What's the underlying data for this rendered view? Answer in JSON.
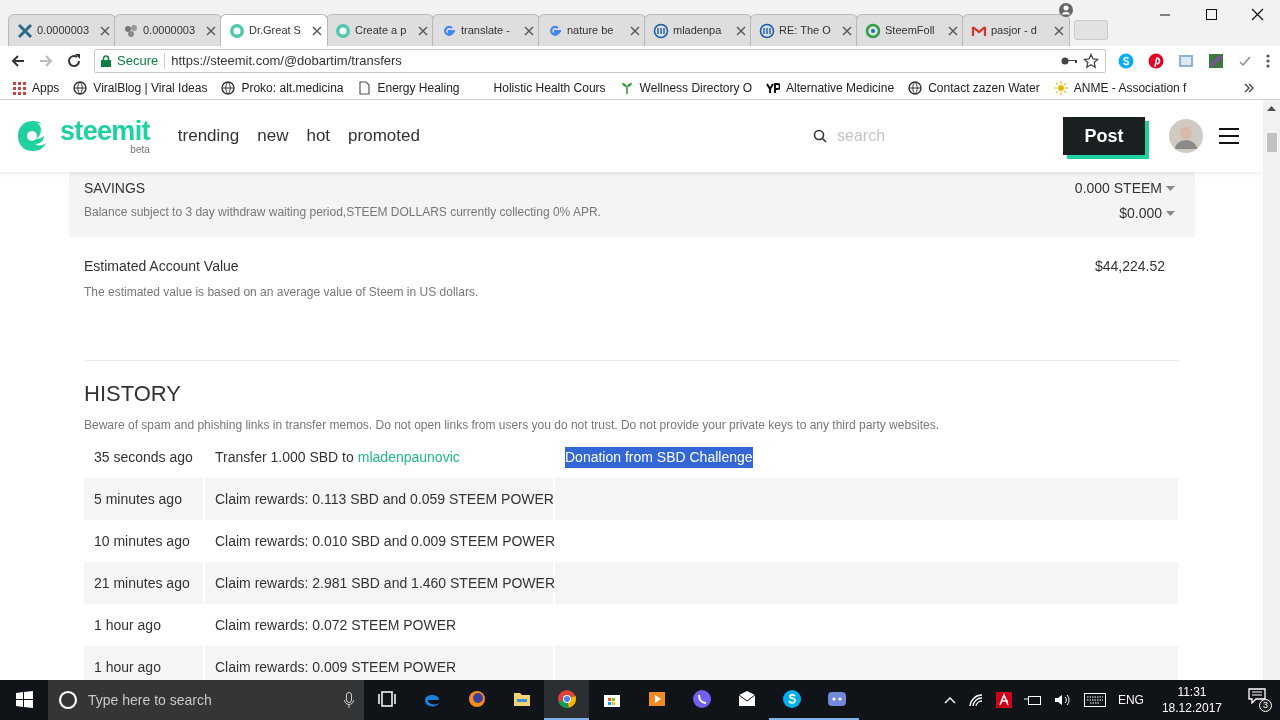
{
  "browser": {
    "tabs": [
      {
        "title": "0.0000003",
        "selected": false
      },
      {
        "title": "0.0000003",
        "selected": false
      },
      {
        "title": "Dr.Great S",
        "selected": true
      },
      {
        "title": "Create a p",
        "selected": false
      },
      {
        "title": "translate -",
        "selected": false
      },
      {
        "title": "nature be",
        "selected": false
      },
      {
        "title": "mladenpa",
        "selected": false
      },
      {
        "title": "RE: The O",
        "selected": false
      },
      {
        "title": "SteemFoll",
        "selected": false
      },
      {
        "title": "pasjor - d",
        "selected": false
      }
    ],
    "secure_label": "Secure",
    "url": "https://steemit.com/@dobartim/transfers",
    "bookmarks": [
      "Apps",
      "ViralBlog | Viral Ideas",
      "Proko: alt.medicina",
      "Energy Healing",
      "Holistic Health Cours",
      "Wellness Directory O",
      "Alternative Medicine",
      "Contact zazen Water",
      "ANME - Association f"
    ]
  },
  "site": {
    "logo": "steemit",
    "logo_sub": "beta",
    "nav": [
      "trending",
      "new",
      "hot",
      "promoted"
    ],
    "search_placeholder": "search",
    "post_button": "Post"
  },
  "savings": {
    "title": "SAVINGS",
    "note": "Balance subject to 3 day withdraw waiting period,STEEM DOLLARS currently collecting 0% APR.",
    "amounts": [
      "0.000 STEEM",
      "$0.000"
    ]
  },
  "estimate": {
    "title": "Estimated Account Value",
    "note": "The estimated value is based on an average value of Steem in US dollars.",
    "value": "$44,224.52"
  },
  "history": {
    "title": "HISTORY",
    "warning": "Beware of spam and phishing links in transfer memos. Do not open links from users you do not trust. Do not provide your private keys to any third party websites.",
    "rows": [
      {
        "time": "35 seconds ago",
        "text": "Transfer 1.000 SBD to",
        "link": "mladenpaunovic",
        "memo": "Donation from SBD Challenge",
        "memo_selected": true
      },
      {
        "time": "5 minutes ago",
        "text": "Claim rewards: 0.113 SBD and 0.059 STEEM POWER"
      },
      {
        "time": "10 minutes ago",
        "text": "Claim rewards: 0.010 SBD and 0.009 STEEM POWER"
      },
      {
        "time": "21 minutes ago",
        "text": "Claim rewards: 2.981 SBD and 1.460 STEEM POWER"
      },
      {
        "time": "1 hour ago",
        "text": "Claim rewards: 0.072 STEEM POWER"
      },
      {
        "time": "1 hour ago",
        "text": "Claim rewards: 0.009 STEEM POWER"
      }
    ]
  },
  "taskbar": {
    "search_placeholder": "Type here to search",
    "apps": [
      {
        "kind": "taskview",
        "open": false
      },
      {
        "kind": "edge",
        "open": false
      },
      {
        "kind": "firefox",
        "open": false
      },
      {
        "kind": "explorer",
        "open": false
      },
      {
        "kind": "chrome",
        "open": true
      },
      {
        "kind": "store",
        "open": false
      },
      {
        "kind": "media",
        "open": false
      },
      {
        "kind": "viber",
        "open": false
      },
      {
        "kind": "mail",
        "open": false
      },
      {
        "kind": "skype",
        "open": true
      },
      {
        "kind": "discord",
        "open": true
      }
    ],
    "language": "ENG",
    "time": "11:31",
    "date": "18.12.2017",
    "notifications": "3"
  }
}
